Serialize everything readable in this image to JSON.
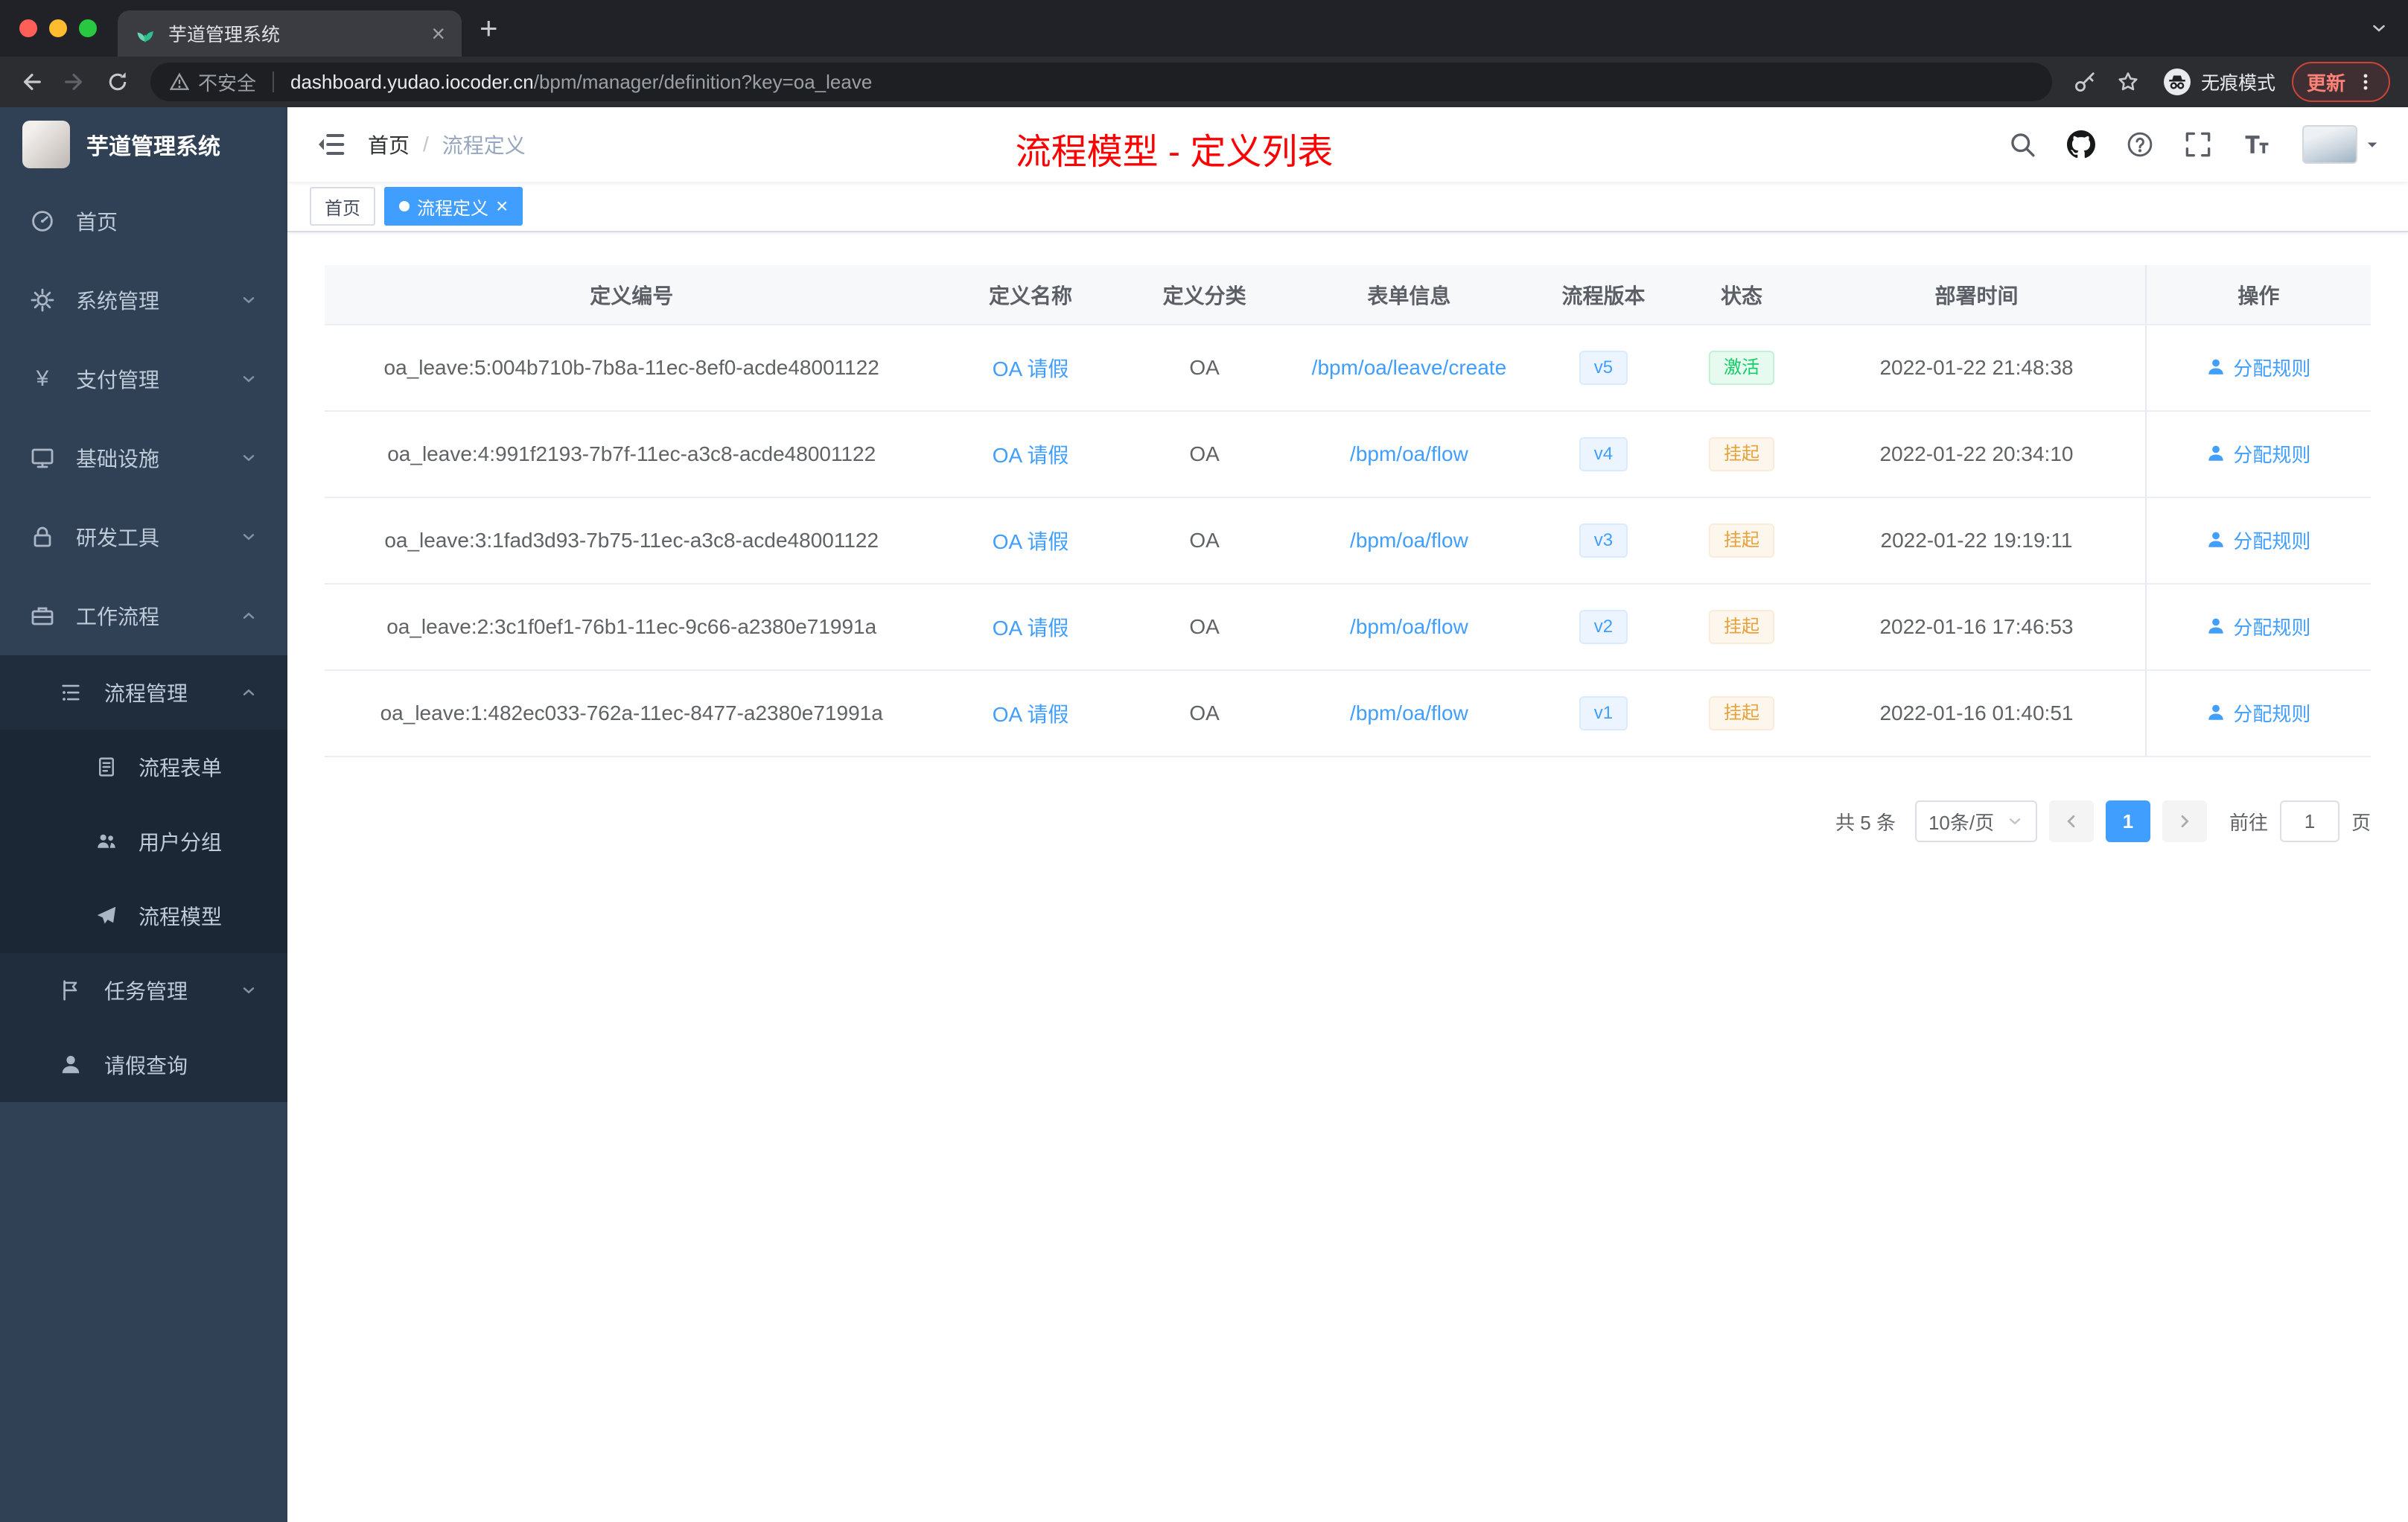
{
  "colors": {
    "accent": "#409eff",
    "annotation_red": "#fe0000",
    "status_active_green": "#13ce66",
    "status_suspended_orange": "#e6a23c",
    "sidebar_bg": "#304156",
    "submenu_bg": "#1f2d3d"
  },
  "browser": {
    "tab_title": "芋道管理系统",
    "security_label": "不安全",
    "url_host": "dashboard.yudao.iocoder.cn",
    "url_path": "/bpm/manager/definition?key=oa_leave",
    "incognito_label": "无痕模式",
    "update_label": "更新"
  },
  "glyphs": {
    "new_tab": "+",
    "tab_close": "×",
    "yen": "¥"
  },
  "sidebar": {
    "logo_title": "芋道管理系统",
    "menu": [
      {
        "label": "首页"
      },
      {
        "label": "系统管理"
      },
      {
        "label": "支付管理"
      },
      {
        "label": "基础设施"
      },
      {
        "label": "研发工具"
      },
      {
        "label": "工作流程",
        "children": [
          {
            "label": "流程管理",
            "children": [
              {
                "label": "流程表单"
              },
              {
                "label": "用户分组"
              },
              {
                "label": "流程模型"
              }
            ]
          },
          {
            "label": "任务管理"
          },
          {
            "label": "请假查询"
          }
        ]
      }
    ]
  },
  "header": {
    "breadcrumb_home": "首页",
    "breadcrumb_separator": "/",
    "breadcrumb_current": "流程定义",
    "annotation": "流程模型 - 定义列表"
  },
  "tags": {
    "home": "首页",
    "active": "流程定义",
    "close_glyph": "×"
  },
  "table": {
    "columns": [
      "定义编号",
      "定义名称",
      "定义分类",
      "表单信息",
      "流程版本",
      "状态",
      "部署时间",
      "操作"
    ],
    "action_label": "分配规则",
    "rows": [
      {
        "id": "oa_leave:5:004b710b-7b8a-11ec-8ef0-acde48001122",
        "name": "OA 请假",
        "category": "OA",
        "form": "/bpm/oa/leave/create",
        "version": "v5",
        "status": "激活",
        "time": "2022-01-22 21:48:38"
      },
      {
        "id": "oa_leave:4:991f2193-7b7f-11ec-a3c8-acde48001122",
        "name": "OA 请假",
        "category": "OA",
        "form": "/bpm/oa/flow",
        "version": "v4",
        "status": "挂起",
        "time": "2022-01-22 20:34:10"
      },
      {
        "id": "oa_leave:3:1fad3d93-7b75-11ec-a3c8-acde48001122",
        "name": "OA 请假",
        "category": "OA",
        "form": "/bpm/oa/flow",
        "version": "v3",
        "status": "挂起",
        "time": "2022-01-22 19:19:11"
      },
      {
        "id": "oa_leave:2:3c1f0ef1-76b1-11ec-9c66-a2380e71991a",
        "name": "OA 请假",
        "category": "OA",
        "form": "/bpm/oa/flow",
        "version": "v2",
        "status": "挂起",
        "time": "2022-01-16 17:46:53"
      },
      {
        "id": "oa_leave:1:482ec033-762a-11ec-8477-a2380e71991a",
        "name": "OA 请假",
        "category": "OA",
        "form": "/bpm/oa/flow",
        "version": "v1",
        "status": "挂起",
        "time": "2022-01-16 01:40:51"
      }
    ]
  },
  "pagination": {
    "total": "共 5 条",
    "page_size": "10条/页",
    "current_page": "1",
    "goto_label": "前往",
    "goto_value": "1",
    "page_unit": "页"
  }
}
